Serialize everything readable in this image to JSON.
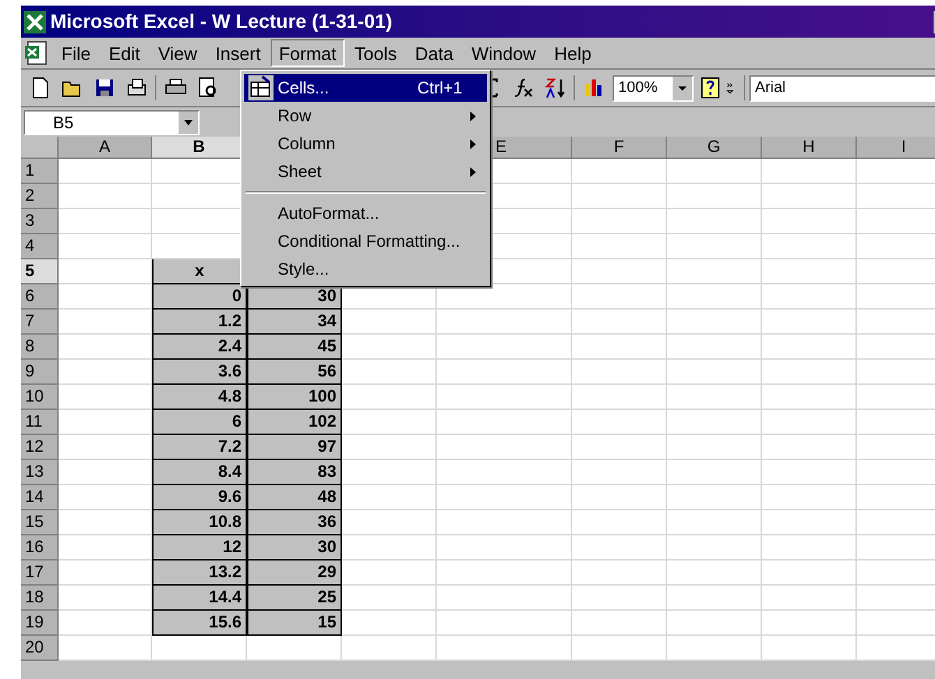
{
  "window": {
    "title": "Microsoft Excel - W Lecture (1-31-01)"
  },
  "menubar": [
    {
      "label": "File",
      "selected": false
    },
    {
      "label": "Edit",
      "selected": false
    },
    {
      "label": "View",
      "selected": false
    },
    {
      "label": "Insert",
      "selected": false
    },
    {
      "label": "Format",
      "selected": true
    },
    {
      "label": "Tools",
      "selected": false
    },
    {
      "label": "Data",
      "selected": false
    },
    {
      "label": "Window",
      "selected": false
    },
    {
      "label": "Help",
      "selected": false
    }
  ],
  "toolbar": {
    "zoom": "100%",
    "font": "Arial"
  },
  "name_box": "B5",
  "format_menu": [
    {
      "kind": "item",
      "label": "Cells...",
      "shortcut": "Ctrl+1",
      "selected": true
    },
    {
      "kind": "submenu",
      "label": "Row",
      "selected": false
    },
    {
      "kind": "submenu",
      "label": "Column",
      "selected": false
    },
    {
      "kind": "submenu",
      "label": "Sheet",
      "selected": false
    },
    {
      "kind": "separator"
    },
    {
      "kind": "item",
      "label": "AutoFormat...",
      "selected": false
    },
    {
      "kind": "item",
      "label": "Conditional Formatting...",
      "selected": false
    },
    {
      "kind": "item",
      "label": "Style...",
      "selected": false
    }
  ],
  "sheet": {
    "columns": [
      {
        "label": "A",
        "selected": false
      },
      {
        "label": "B",
        "selected": true
      },
      {
        "label": "E",
        "selected": false
      },
      {
        "label": "F",
        "selected": false
      },
      {
        "label": "G",
        "selected": false
      },
      {
        "label": "H",
        "selected": false
      },
      {
        "label": "I",
        "selected": false
      }
    ],
    "rows": [
      {
        "label": "1",
        "selected": false,
        "cells": []
      },
      {
        "label": "2",
        "selected": false,
        "cells": []
      },
      {
        "label": "3",
        "selected": false,
        "cells": []
      },
      {
        "label": "4",
        "selected": false,
        "cells": []
      },
      {
        "label": "5",
        "selected": true,
        "cells": [
          "",
          "x"
        ]
      },
      {
        "label": "6",
        "selected": false,
        "cells": [
          "",
          "0",
          "30"
        ]
      },
      {
        "label": "7",
        "selected": false,
        "cells": [
          "",
          "1.2",
          "34"
        ]
      },
      {
        "label": "8",
        "selected": false,
        "cells": [
          "",
          "2.4",
          "45"
        ]
      },
      {
        "label": "9",
        "selected": false,
        "cells": [
          "",
          "3.6",
          "56"
        ]
      },
      {
        "label": "10",
        "selected": false,
        "cells": [
          "",
          "4.8",
          "100"
        ]
      },
      {
        "label": "11",
        "selected": false,
        "cells": [
          "",
          "6",
          "102"
        ]
      },
      {
        "label": "12",
        "selected": false,
        "cells": [
          "",
          "7.2",
          "97"
        ]
      },
      {
        "label": "13",
        "selected": false,
        "cells": [
          "",
          "8.4",
          "83"
        ]
      },
      {
        "label": "14",
        "selected": false,
        "cells": [
          "",
          "9.6",
          "48"
        ]
      },
      {
        "label": "15",
        "selected": false,
        "cells": [
          "",
          "10.8",
          "36"
        ]
      },
      {
        "label": "16",
        "selected": false,
        "cells": [
          "",
          "12",
          "30"
        ]
      },
      {
        "label": "17",
        "selected": false,
        "cells": [
          "",
          "13.2",
          "29"
        ]
      },
      {
        "label": "18",
        "selected": false,
        "cells": [
          "",
          "14.4",
          "25"
        ]
      },
      {
        "label": "19",
        "selected": false,
        "cells": [
          "",
          "15.6",
          "15"
        ]
      },
      {
        "label": "20",
        "selected": false,
        "cells": []
      }
    ]
  }
}
